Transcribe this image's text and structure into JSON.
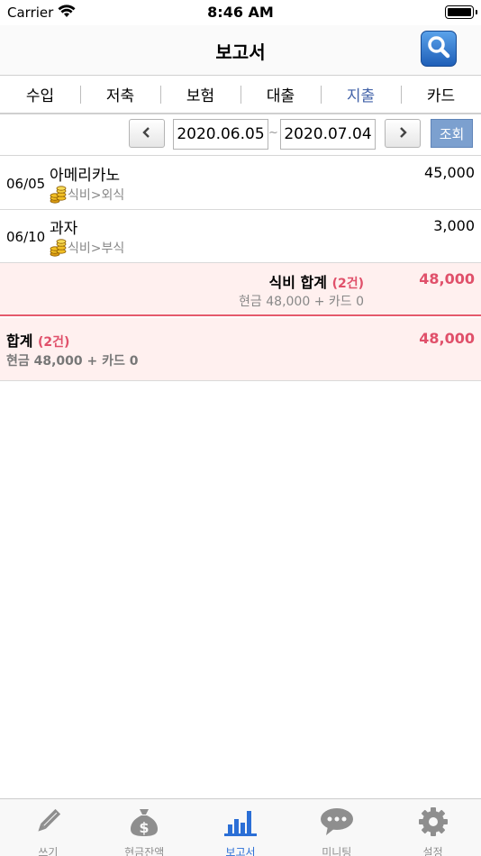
{
  "status_bar": {
    "carrier": "Carrier",
    "time": "8:46 AM"
  },
  "header": {
    "title": "보고서"
  },
  "category_tabs": [
    {
      "label": "수입"
    },
    {
      "label": "저축"
    },
    {
      "label": "보험"
    },
    {
      "label": "대출"
    },
    {
      "label": "지출",
      "active": true
    },
    {
      "label": "카드"
    }
  ],
  "filter": {
    "start_date": "2020.06.05",
    "separator": "~",
    "end_date": "2020.07.04",
    "query_label": "조회"
  },
  "entries": [
    {
      "date": "06/05",
      "name": "아메리카노",
      "category": "식비>외식",
      "amount": "45,000"
    },
    {
      "date": "06/10",
      "name": "과자",
      "category": "식비>부식",
      "amount": "3,000"
    }
  ],
  "subtotal": {
    "label": "식비 합계",
    "count": "(2건)",
    "amount": "48,000",
    "detail": "현금 48,000 + 카드 0"
  },
  "total": {
    "label": "합계",
    "count": "(2건)",
    "amount": "48,000",
    "detail": "현금 48,000 + 카드 0"
  },
  "tab_bar": [
    {
      "label": "쓰기",
      "icon": "pencil-icon"
    },
    {
      "label": "현금잔액",
      "icon": "money-bag-icon"
    },
    {
      "label": "보고서",
      "icon": "bar-chart-icon",
      "active": true
    },
    {
      "label": "미니팅",
      "icon": "chat-bubble-icon"
    },
    {
      "label": "설정",
      "icon": "gear-icon"
    }
  ],
  "colors": {
    "accent": "#2b6fd6",
    "active_tab": "#4262a8",
    "total_red": "#e0506a",
    "total_bg": "#fff0ef"
  }
}
